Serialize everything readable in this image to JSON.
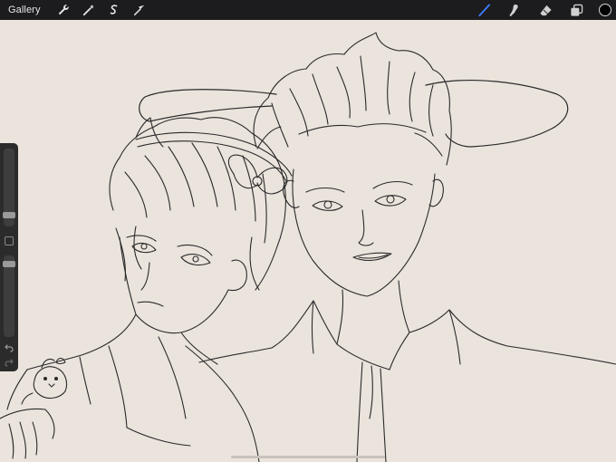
{
  "topbar": {
    "gallery_label": "Gallery",
    "left_tools": [
      "wrench-icon",
      "magic-wand-icon",
      "selection-icon",
      "transform-icon"
    ],
    "right_tools": [
      "brush-icon",
      "smudge-icon",
      "eraser-icon",
      "layers-icon"
    ],
    "active_tool": "brush-icon",
    "active_tool_color": "#3d7bff",
    "current_color": "#000000"
  },
  "canvas": {
    "background": "#ebe4dc",
    "stroke_color": "#2a2a2a"
  }
}
